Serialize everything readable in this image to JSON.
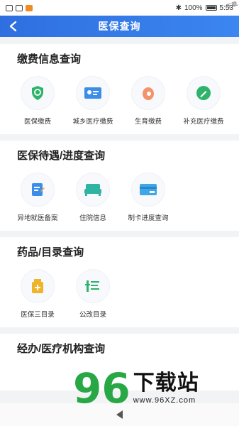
{
  "status_bar": {
    "battery": "100%",
    "time": "5:53"
  },
  "header": {
    "title": "医保查询"
  },
  "sections": [
    {
      "title": "缴费信息查询",
      "items": [
        {
          "label": "医保缴费",
          "icon": "shield-icon"
        },
        {
          "label": "城乡医疗缴费",
          "icon": "id-card-icon"
        },
        {
          "label": "生育缴费",
          "icon": "maternity-icon"
        },
        {
          "label": "补充医疗缴费",
          "icon": "edit-icon"
        }
      ]
    },
    {
      "title": "医保待遇/进度查询",
      "items": [
        {
          "label": "异地就医备案",
          "icon": "clipboard-icon"
        },
        {
          "label": "住院信息",
          "icon": "bed-icon"
        },
        {
          "label": "制卡进度查询",
          "icon": "card-icon"
        }
      ]
    },
    {
      "title": "药品/目录查询",
      "items": [
        {
          "label": "医保三目录",
          "icon": "medicine-bottle-icon"
        },
        {
          "label": "公改目录",
          "icon": "list-icon"
        }
      ]
    },
    {
      "title": "经办/医疗机构查询",
      "items": []
    }
  ],
  "watermark": {
    "logo": "96",
    "text": "下载站",
    "url": "www.96XZ.com"
  },
  "corner_tag": "下载"
}
